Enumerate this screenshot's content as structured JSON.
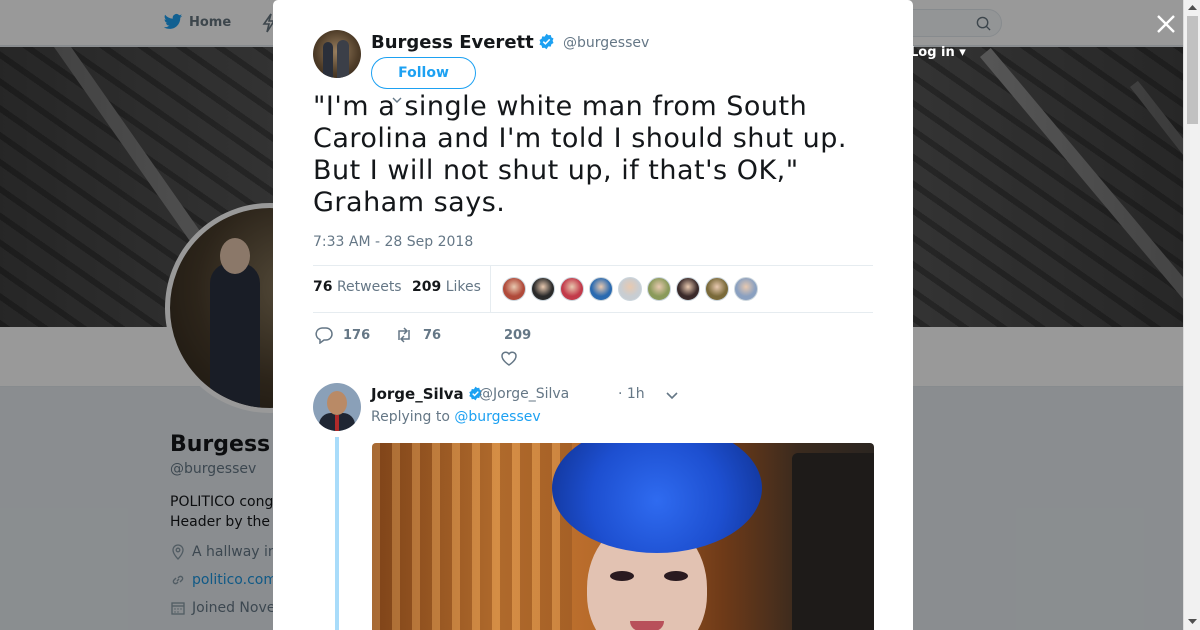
{
  "nav": {
    "home_label": "Home",
    "login_label": "Log in"
  },
  "profile": {
    "name": "Burgess",
    "handle": "@burgessev",
    "bio_line1": "POLITICO cong",
    "bio_line2": "Header by the",
    "location": "A hallway in",
    "website": "politico.com",
    "joined": "Joined Nove"
  },
  "tweet": {
    "author_name": "Burgess Everett",
    "author_handle": "@burgessev",
    "follow_label": "Follow",
    "text": "\"I'm a single white man from South Carolina and I'm told I should shut up. But I will not shut up, if that's OK,\" Graham says.",
    "timestamp": "7:33 AM - 28 Sep 2018",
    "retweets_count": "76",
    "retweets_label": "Retweets",
    "likes_count": "209",
    "likes_label": "Likes",
    "liker_colors": [
      "#b04a3a",
      "#2a2a2a",
      "#c23a4a",
      "#2a6ab0",
      "#c8cdd2",
      "#8a9a5a",
      "#3a2a2a",
      "#7a6a3a",
      "#8aa0c0"
    ],
    "actions": {
      "replies": "176",
      "retweets": "76",
      "likes": "209"
    }
  },
  "reply": {
    "name": "Jorge_Silva",
    "handle": "@Jorge_Silva",
    "time": "· 1h",
    "replying_prefix": "Replying to",
    "replying_to": "@burgessev"
  },
  "colors": {
    "accent": "#1da1f2",
    "text_primary": "#14171a",
    "text_secondary": "#657786"
  }
}
